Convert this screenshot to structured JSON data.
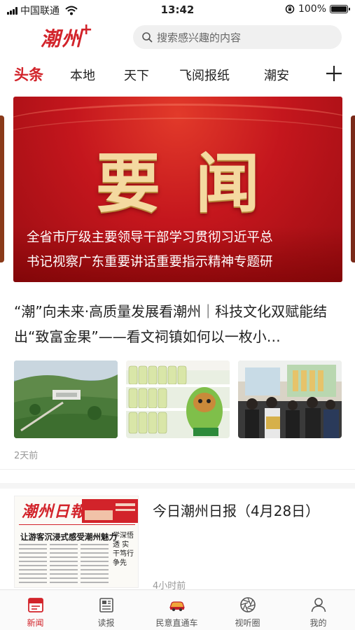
{
  "status_bar": {
    "carrier": "中国联通",
    "time": "13:42",
    "battery_percent": "100%",
    "battery_level": 1.0
  },
  "header": {
    "logo_text": "潮州",
    "logo_plus": "+",
    "search_placeholder": "搜索感兴趣的内容"
  },
  "tabs": [
    {
      "label": "头条",
      "active": true
    },
    {
      "label": "本地",
      "active": false
    },
    {
      "label": "天下",
      "active": false
    },
    {
      "label": "飞阅报纸",
      "active": false
    },
    {
      "label": "潮安",
      "active": false
    }
  ],
  "banner": {
    "title": "要闻",
    "caption_line1": "全省市厅级主要领导干部学习贯彻习近平总",
    "caption_line2": "书记视察广东重要讲话重要指示精神专题研"
  },
  "articles": [
    {
      "title": "“潮”向未来·高质量发展看潮州｜科技文化双赋能结出“致富金果”——看文祠镇如何以一枚小…",
      "time": "2天前"
    },
    {
      "title": "今日潮州日报（4月28日）",
      "time": "4小时前",
      "paper_masthead": "潮州日報",
      "paper_headline": "让游客沉浸式感受潮州魅力",
      "paper_subhead": "学深悟透 实干笃行 争先"
    }
  ],
  "bottom_nav": [
    {
      "label": "新闻",
      "icon": "news-icon",
      "active": true
    },
    {
      "label": "读报",
      "icon": "newspaper-icon",
      "active": false
    },
    {
      "label": "民意直通车",
      "icon": "car-icon",
      "active": false
    },
    {
      "label": "视听圈",
      "icon": "aperture-icon",
      "active": false
    },
    {
      "label": "我的",
      "icon": "user-icon",
      "active": false
    }
  ],
  "colors": {
    "brand_red": "#d2232a",
    "banner_gold": "#f4d9a0"
  }
}
